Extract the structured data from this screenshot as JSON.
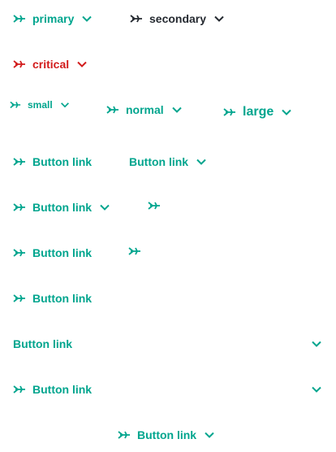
{
  "colors": {
    "primary": "#00a58e",
    "secondary": "#252a31",
    "critical": "#d21c1c"
  },
  "icons": {
    "leading": "airplane-icon",
    "trailing": "chevron-down-icon"
  },
  "types": {
    "primary": "primary",
    "secondary": "secondary",
    "critical": "critical"
  },
  "sizes": {
    "small": "small",
    "normal": "normal",
    "large": "large"
  },
  "button_link": "Button link"
}
